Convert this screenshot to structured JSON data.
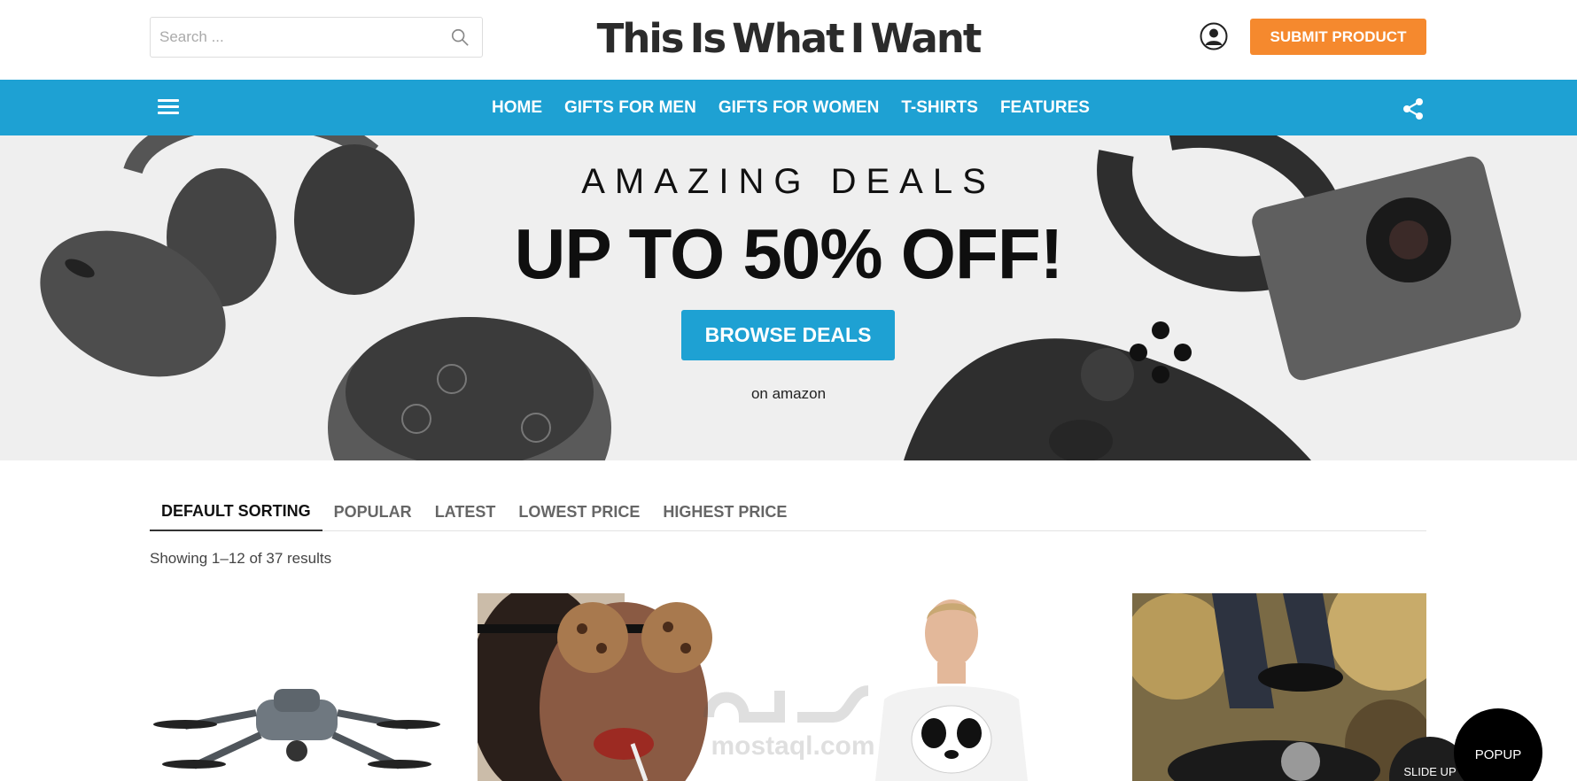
{
  "header": {
    "search_placeholder": "Search ...",
    "search_icon": "search-icon",
    "logo_words": [
      "This",
      "Is",
      "What",
      "I",
      "Want"
    ],
    "logo_dot_colors": [
      "#f5892e",
      "#1ea1d3",
      "#f5892e",
      "#1ea1d3"
    ],
    "user_icon": "user-circle-icon",
    "submit_label": "SUBMIT PRODUCT"
  },
  "nav": {
    "menu_icon": "hamburger-menu-icon",
    "items": [
      {
        "label": "HOME"
      },
      {
        "label": "GIFTS FOR MEN"
      },
      {
        "label": "GIFTS FOR WOMEN"
      },
      {
        "label": "T-SHIRTS"
      },
      {
        "label": "FEATURES"
      }
    ],
    "share_icon": "share-icon"
  },
  "hero": {
    "eyebrow": "AMAZING DEALS",
    "title": "UP TO 50% OFF!",
    "button_label": "BROWSE DEALS",
    "subtext": "on amazon"
  },
  "sorting": {
    "tabs": [
      {
        "label": "DEFAULT SORTING",
        "active": true
      },
      {
        "label": "POPULAR",
        "active": false
      },
      {
        "label": "LATEST",
        "active": false
      },
      {
        "label": "LOWEST PRICE",
        "active": false
      },
      {
        "label": "HIGHEST PRICE",
        "active": false
      }
    ],
    "results_text": "Showing 1–12 of 37 results"
  },
  "watermark": {
    "text": "mostaql.com"
  },
  "floating": {
    "popup_label": "POPUP",
    "slideup_label": "SLIDE UP"
  },
  "colors": {
    "brand_blue": "#1ea1d3",
    "accent_orange": "#f5892e"
  }
}
